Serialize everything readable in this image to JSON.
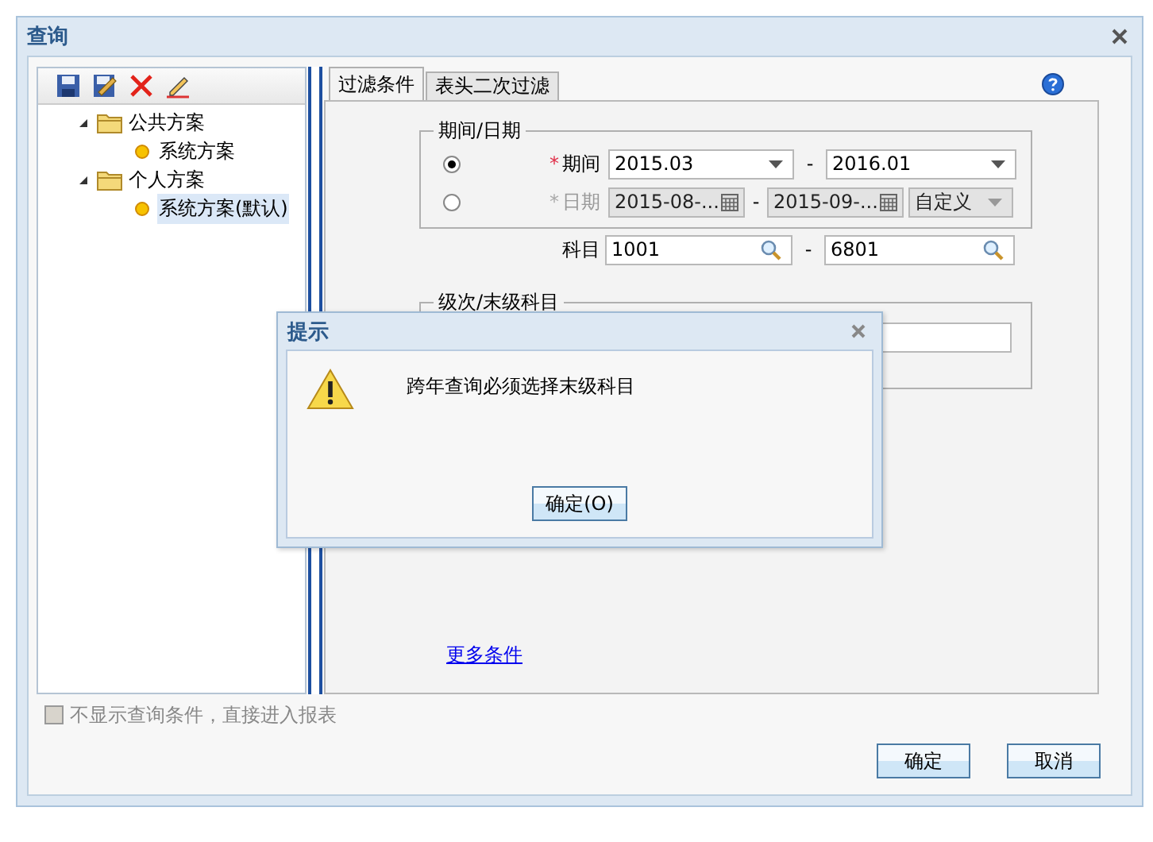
{
  "window": {
    "title": "查询"
  },
  "tree": [
    {
      "label": "公共方案",
      "expanded": true,
      "children": [
        {
          "label": "系统方案",
          "selected": false
        }
      ]
    },
    {
      "label": "个人方案",
      "expanded": true,
      "children": [
        {
          "label": "系统方案(默认)",
          "selected": true
        }
      ]
    }
  ],
  "tabs": [
    {
      "label": "过滤条件",
      "selected": true
    },
    {
      "label": "表头二次过滤",
      "selected": false
    }
  ],
  "period_group": {
    "title": "期间/日期",
    "separator": "-",
    "rows": [
      {
        "kind": "combo",
        "marker": "*",
        "label": "期间",
        "selected": true,
        "disabled": false,
        "from": "2015.03",
        "to": "2016.01"
      },
      {
        "kind": "date",
        "marker": "*",
        "label": "日期",
        "selected": false,
        "disabled": true,
        "from": "2015-08-...",
        "to": "2015-09-...",
        "range": "自定义"
      }
    ]
  },
  "subject": {
    "label": "科目",
    "separator": "-",
    "from": "1001",
    "to": "6801"
  },
  "level_group": {
    "title": "级次/末级科目"
  },
  "more_link": "更多条件",
  "skip_option": {
    "label": "不显示查询条件，直接进入报表",
    "checked": false,
    "disabled": true
  },
  "buttons": [
    "确定",
    "取消"
  ],
  "dialog": {
    "title": "提示",
    "message": "跨年查询必须选择末级科目",
    "button": "确定(O)"
  }
}
